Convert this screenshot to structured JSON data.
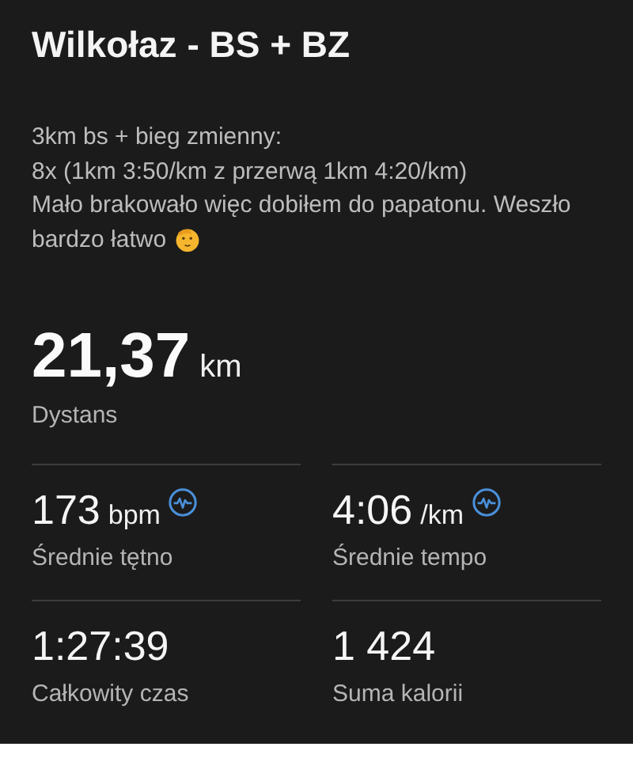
{
  "title": "Wilkołaz - BS + BZ",
  "description": [
    "3km bs + bieg zmienny:",
    "8x (1km 3:50/km z przerwą 1km 4:20/km)",
    "Mało brakowało więc dobiłem do papatonu. Weszło",
    "bardzo łatwo"
  ],
  "main_stat": {
    "value": "21,37",
    "unit": "km",
    "label": "Dystans"
  },
  "stats": [
    {
      "value": "173",
      "unit": "bpm",
      "label": "Średnie tętno",
      "has_chart_icon": true
    },
    {
      "value": "4:06",
      "unit": "/km",
      "label": "Średnie tempo",
      "has_chart_icon": true
    },
    {
      "value": "1:27:39",
      "label": "Całkowity czas",
      "has_chart_icon": false
    },
    {
      "value": "1 424",
      "label": "Suma kalorii",
      "has_chart_icon": false
    }
  ]
}
